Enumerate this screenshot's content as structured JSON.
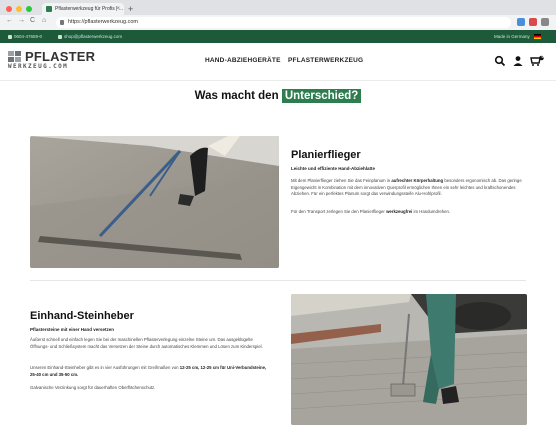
{
  "browser": {
    "tab_title": "Pflasterwerkzeug für Profis | ...",
    "tab_close": "×",
    "new_tab": "+",
    "url": "https://pflasterwerkzeug.com",
    "nav_back": "←",
    "nav_forward": "→",
    "nav_reload": "C",
    "nav_home": "⌂"
  },
  "topbar": {
    "phone": "0604-47659-0",
    "email": "shop@pflasterwerkzeug.com",
    "made_in": "Made in Germany"
  },
  "header": {
    "logo_top": "PFLASTER",
    "logo_bottom": "WERKZEUG.COM",
    "nav": [
      "HAND-ABZIEHGERÄTE",
      "PFLASTERWERKZEUG"
    ],
    "cart_count": "0",
    "icons": [
      "search-icon",
      "user-icon",
      "cart-icon"
    ]
  },
  "headline": {
    "text": "Was macht den",
    "highlight": "Unterschied?"
  },
  "section1": {
    "title": "Planierflieger",
    "subtitle": "Leichte und effiziente Hand-Abziehlatte",
    "para1_a": "Mit dem Planierflieger ziehen Sie das Feinplanum in ",
    "para1_bold": "aufrechter Körperhaltung",
    "para1_b": " besonders ergonomisch ab. Das geringe Eigengewicht in Kombination mit dem innovativen Querprofil ermöglichen Ihnen ein sehr leichtes und kraftschonendes Abziehen. Für ein perfektes Planum sorgt das verwindungssteife Alu-Hohlprofil.",
    "para2_a": "Für den Transport zerlegen Sie den Planierflieger ",
    "para2_bold": "werkzeugfrei",
    "para2_b": " im Handumdrehen."
  },
  "section2": {
    "title": "Einhand-Steinheber",
    "subtitle": "Pflastersteine mit einer Hand versetzen",
    "para1": "Äußerst schnell und einfach legen Sie bei der maschinellen Pflasterverlegung einzelne Steine um. Das ausgeklügelte Öffnungs- und Schließsystem macht das Versetzen der Steine durch automatisches Klemmen und Lösen zum Kinderspiel.",
    "para2_a": "Unseren Einhand-Steinheber gibt es in vier Ausführungen mit Greifmaßen von ",
    "para2_bold": "12-25 cm, 12-25 cm für Uni-Verbundsteine, 25-40 cm und 35-50 cm.",
    "para3": "Galvanische Verzinkung sorgt für dauerhaften Oberflächenschutz."
  },
  "colors": {
    "brand_green": "#1c5a3a",
    "accent_green": "#2e7d4f"
  }
}
